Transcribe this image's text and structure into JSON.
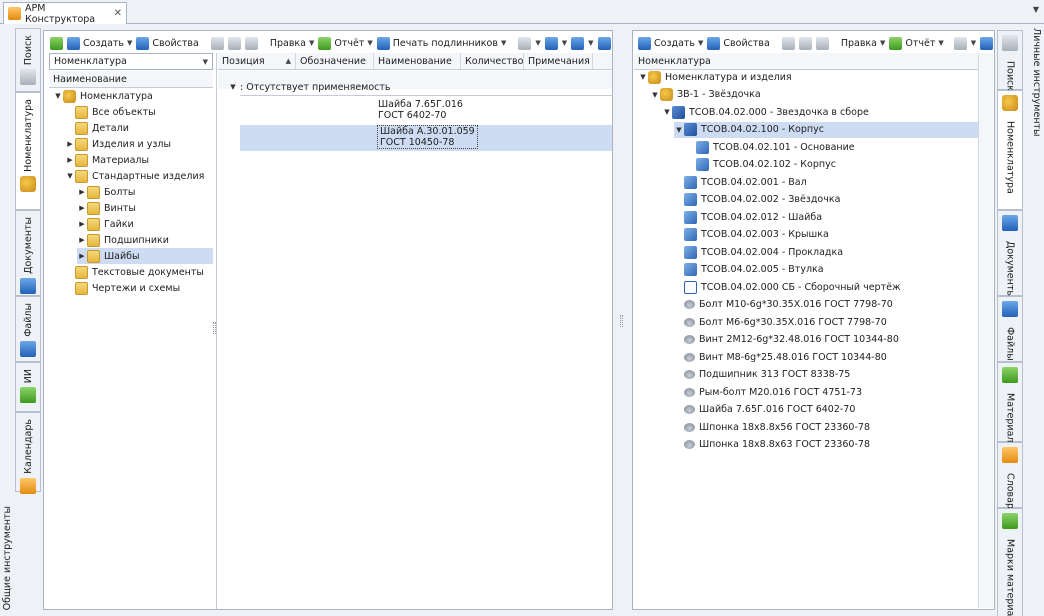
{
  "doc_tab": {
    "label": "АРМ Конструктора",
    "close": "✕"
  },
  "left_side_caption": "Общие инструменты",
  "right_side_caption": "Личные инструменты",
  "left_vtabs": [
    {
      "label": "Поиск",
      "icon": "binoculars-icon"
    },
    {
      "label": "Номенклатура",
      "icon": "nomenclature-icon"
    },
    {
      "label": "Документы",
      "icon": "document-icon"
    },
    {
      "label": "Файлы",
      "icon": "files-icon"
    },
    {
      "label": "ИИ",
      "icon": "ii-icon"
    },
    {
      "label": "Календарь",
      "icon": "calendar-icon"
    }
  ],
  "right_vtabs": [
    {
      "label": "Поиск",
      "icon": "binoculars-icon"
    },
    {
      "label": "Номенклатура",
      "icon": "nomenclature-icon"
    },
    {
      "label": "Документы",
      "icon": "document-icon"
    },
    {
      "label": "Файлы",
      "icon": "files-icon"
    },
    {
      "label": "Материал",
      "icon": "material-icon"
    },
    {
      "label": "Словарь",
      "icon": "dictionary-icon"
    },
    {
      "label": "Марки материалов",
      "icon": "material-grades-icon"
    }
  ],
  "left_toolbar": {
    "create": "Создать",
    "properties": "Свойства",
    "edit": "Правка",
    "report": "Отчёт",
    "print_originals": "Печать подлинников"
  },
  "right_toolbar": {
    "create": "Создать",
    "properties": "Свойства",
    "edit": "Правка",
    "report": "Отчёт"
  },
  "left_tree": {
    "combo": "Номенклатура",
    "header": "Наименование",
    "items": [
      {
        "label": "Номенклатура",
        "level": 0,
        "expander": "▼",
        "icon": "nomenclature-icon"
      },
      {
        "label": "Все объекты",
        "level": 1,
        "expander": "",
        "icon": "folder-icon"
      },
      {
        "label": "Детали",
        "level": 1,
        "expander": "",
        "icon": "folder-icon"
      },
      {
        "label": "Изделия и узлы",
        "level": 1,
        "expander": "▶",
        "icon": "folder-icon"
      },
      {
        "label": "Материалы",
        "level": 1,
        "expander": "▶",
        "icon": "folder-icon"
      },
      {
        "label": "Стандартные изделия",
        "level": 1,
        "expander": "▼",
        "icon": "folder-icon"
      },
      {
        "label": "Болты",
        "level": 2,
        "expander": "▶",
        "icon": "folder-icon"
      },
      {
        "label": "Винты",
        "level": 2,
        "expander": "▶",
        "icon": "folder-icon"
      },
      {
        "label": "Гайки",
        "level": 2,
        "expander": "▶",
        "icon": "folder-icon"
      },
      {
        "label": "Подшипники",
        "level": 2,
        "expander": "▶",
        "icon": "folder-icon"
      },
      {
        "label": "Шайбы",
        "level": 2,
        "expander": "▶",
        "icon": "folder-icon",
        "selected": true
      },
      {
        "label": "Текстовые документы",
        "level": 1,
        "expander": "",
        "icon": "folder-icon"
      },
      {
        "label": "Чертежи и схемы",
        "level": 1,
        "expander": "",
        "icon": "folder-icon"
      }
    ]
  },
  "middle_table": {
    "columns": [
      "Позиция",
      "Обозначение",
      "Наименование",
      "Количество",
      "Примечания"
    ],
    "sort_marker": "▲",
    "group_label": ": Отсутствует применяемость",
    "group_expander": "▼",
    "rows": [
      {
        "name_line1": "Шайба 7.65Г.016",
        "name_line2": "ГОСТ 6402-70",
        "selected": false
      },
      {
        "name_line1": "Шайба А.30.01.059",
        "name_line2": "ГОСТ 10450-78",
        "selected": true
      }
    ]
  },
  "right_tree": {
    "header": "Номенклатура",
    "items": [
      {
        "label": "Номенклатура и изделия",
        "level": 0,
        "expander": "▼",
        "icon": "nomenclature-icon"
      },
      {
        "label": "ЗВ-1 - Звёздочка",
        "level": 1,
        "expander": "▼",
        "icon": "nomenclature-icon"
      },
      {
        "label": "ТСОВ.04.02.000 - Звездочка в сборе",
        "level": 2,
        "expander": "▼",
        "icon": "assembly-icon"
      },
      {
        "label": "ТСОВ.04.02.100 - Корпус",
        "level": 3,
        "expander": "▼",
        "icon": "assembly-icon",
        "selected": true
      },
      {
        "label": "ТСОВ.04.02.101 - Основание",
        "level": 4,
        "expander": "",
        "icon": "part-icon"
      },
      {
        "label": "ТСОВ.04.02.102 - Корпус",
        "level": 4,
        "expander": "",
        "icon": "part-icon"
      },
      {
        "label": "ТСОВ.04.02.001 - Вал",
        "level": 3,
        "expander": "",
        "icon": "part-icon"
      },
      {
        "label": "ТСОВ.04.02.002 - Звёздочка",
        "level": 3,
        "expander": "",
        "icon": "part-icon"
      },
      {
        "label": "ТСОВ.04.02.012 - Шайба",
        "level": 3,
        "expander": "",
        "icon": "part-icon"
      },
      {
        "label": "ТСОВ.04.02.003 - Крышка",
        "level": 3,
        "expander": "",
        "icon": "part-icon"
      },
      {
        "label": "ТСОВ.04.02.004 - Прокладка",
        "level": 3,
        "expander": "",
        "icon": "part-icon"
      },
      {
        "label": "ТСОВ.04.02.005 - Втулка",
        "level": 3,
        "expander": "",
        "icon": "part-icon"
      },
      {
        "label": "ТСОВ.04.02.000 СБ - Сборочный чертёж",
        "level": 3,
        "expander": "",
        "icon": "drawing-icon"
      },
      {
        "label": "Болт М10-6g*30.35Х.016 ГОСТ 7798-70",
        "level": 3,
        "expander": "",
        "icon": "standard-part-icon"
      },
      {
        "label": "Болт М6-6g*30.35Х.016 ГОСТ 7798-70",
        "level": 3,
        "expander": "",
        "icon": "standard-part-icon"
      },
      {
        "label": "Винт 2М12-6g*32.48.016 ГОСТ 10344-80",
        "level": 3,
        "expander": "",
        "icon": "standard-part-icon"
      },
      {
        "label": "Винт М8-6g*25.48.016 ГОСТ 10344-80",
        "level": 3,
        "expander": "",
        "icon": "standard-part-icon"
      },
      {
        "label": "Подшипник 313 ГОСТ 8338-75",
        "level": 3,
        "expander": "",
        "icon": "standard-part-icon"
      },
      {
        "label": "Рым-болт М20.016 ГОСТ 4751-73",
        "level": 3,
        "expander": "",
        "icon": "standard-part-icon"
      },
      {
        "label": "Шайба 7.65Г.016 ГОСТ 6402-70",
        "level": 3,
        "expander": "",
        "icon": "standard-part-icon"
      },
      {
        "label": "Шпонка 18x8.8x56 ГОСТ 23360-78",
        "level": 3,
        "expander": "",
        "icon": "standard-part-icon"
      },
      {
        "label": "Шпонка 18x8.8x63 ГОСТ 23360-78",
        "level": 3,
        "expander": "",
        "icon": "standard-part-icon"
      }
    ]
  },
  "colors": {
    "selection": "#cddcf3",
    "border": "#a9b3c3",
    "chrome": "#eef1f5"
  }
}
